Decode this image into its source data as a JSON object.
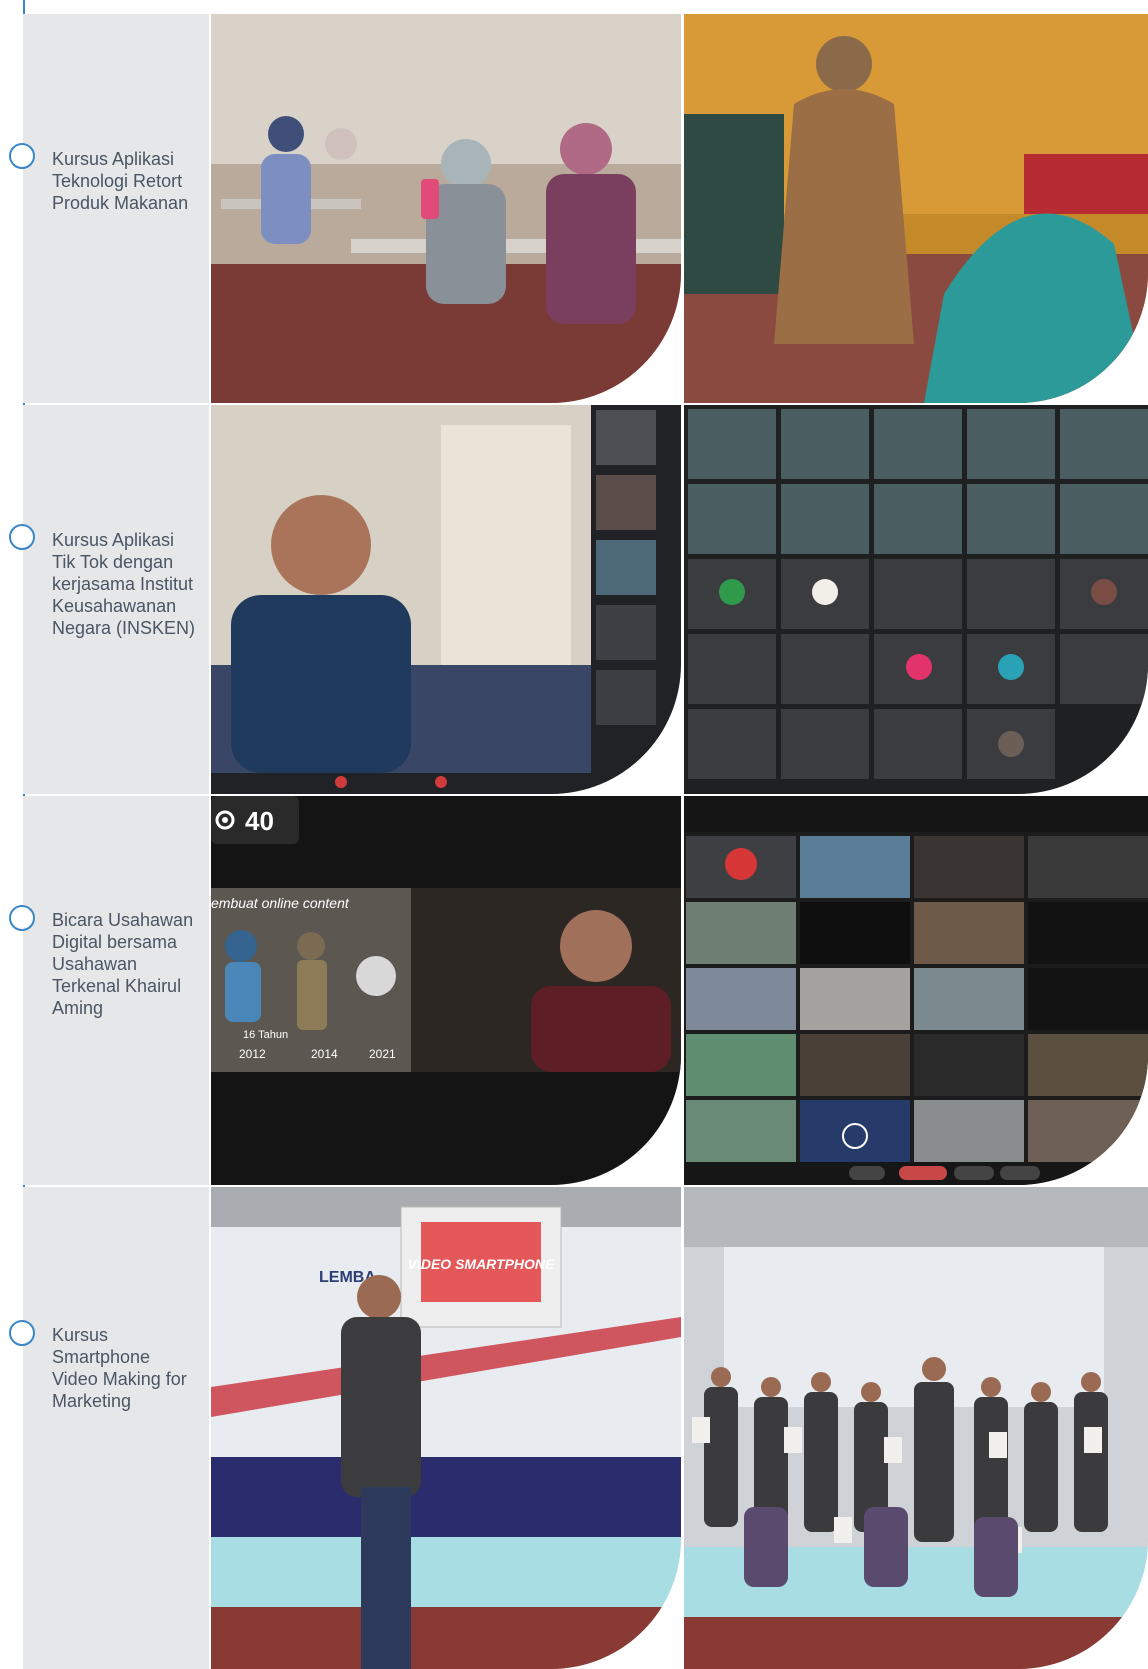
{
  "rows": [
    {
      "label": "Kursus Aplikasi Teknologi Retort Produk Makanan",
      "photos": [
        "classroom-seminar-photo",
        "speaker-with-microphone-photo"
      ]
    },
    {
      "label": "Kursus Aplikasi Tik Tok dengan kerjasama Institut Keusahawanan Negara (INSKEN)",
      "photos": [
        "video-call-speaker-photo",
        "video-call-participants-grid-photo"
      ]
    },
    {
      "label": "Bicara Usahawan Digital bersama Usahawan Terkenal Khairul Aming",
      "photos": [
        "live-stream-presenter-photo",
        "online-meeting-gallery-photo"
      ],
      "viewer_count": "40",
      "timeline_years": [
        "2012",
        "2014",
        "2021"
      ],
      "slide_caption": "embuat online content",
      "slide_badge": "16 Tahun"
    },
    {
      "label": "Kursus Smartphone Video Making for Marketing",
      "photos": [
        "presenter-on-stage-photo",
        "group-photo-with-certificates"
      ],
      "slide_title": "VIDEO SMARTPHONE",
      "banner_text": "LEMBA"
    }
  ],
  "colors": {
    "timeline": "#3b86c6",
    "label_panel": "#e6e7e8",
    "label_text": "#4a5664"
  }
}
